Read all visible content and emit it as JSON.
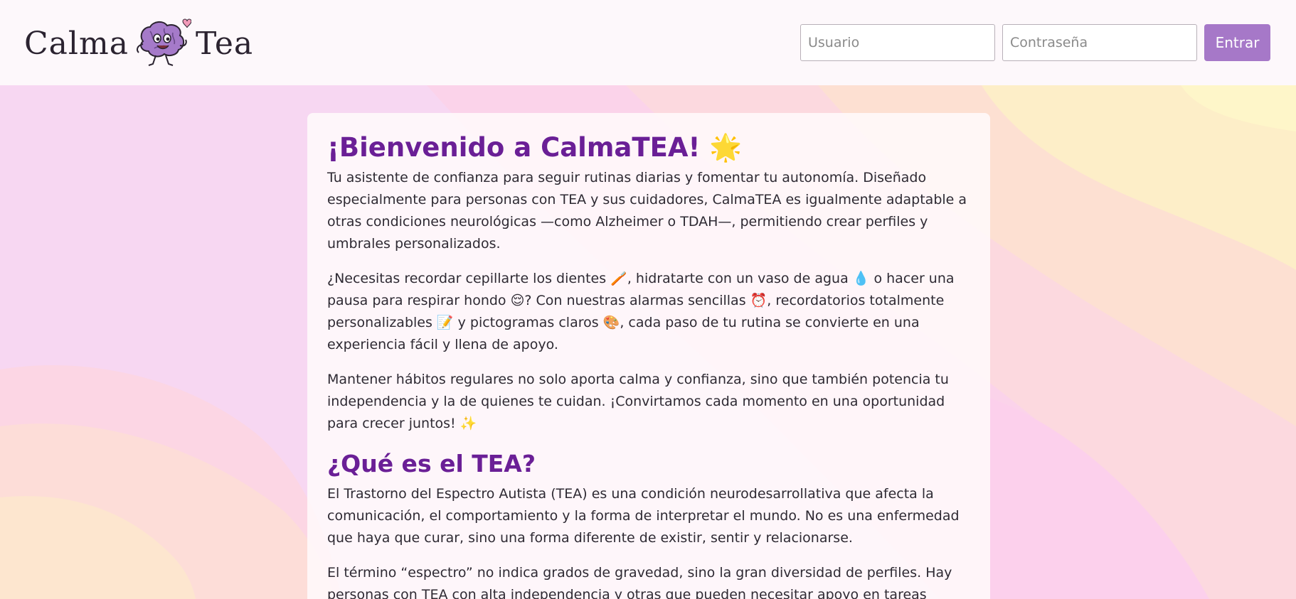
{
  "header": {
    "logo": {
      "word_left": "Calma",
      "word_right": "Tea"
    },
    "login": {
      "username_placeholder": "Usuario",
      "password_placeholder": "Contraseña",
      "submit_label": "Entrar"
    }
  },
  "main": {
    "welcome_title": "¡Bienvenido a CalmaTEA! 🌟",
    "welcome_paragraphs": [
      "Tu asistente de confianza para seguir rutinas diarias y fomentar tu autonomía. Diseñado especialmente para personas con TEA y sus cuidadores, CalmaTEA es igualmente adaptable a otras condiciones neurológicas —como Alzheimer o TDAH—, permitiendo crear perfiles y umbrales personalizados.",
      "¿Necesitas recordar cepillarte los dientes 🪥, hidratarte con un vaso de agua 💧 o hacer una pausa para respirar hondo 😌? Con nuestras alarmas sencillas ⏰, recordatorios totalmente personalizables 📝 y pictogramas claros 🎨, cada paso de tu rutina se convierte en una experiencia fácil y llena de apoyo.",
      "Mantener hábitos regulares no solo aporta calma y confianza, sino que también potencia tu independencia y la de quienes te cuidan. ¡Convirtamos cada momento en una oportunidad para crecer juntos! ✨"
    ],
    "tea_title": "¿Qué es el TEA?",
    "tea_paragraphs": [
      "El Trastorno del Espectro Autista (TEA) es una condición neurodesarrollativa que afecta la comunicación, el comportamiento y la forma de interpretar el mundo. No es una enfermedad que haya que curar, sino una forma diferente de existir, sentir y relacionarse.",
      "El término “espectro” no indica grados de gravedad, sino la gran diversidad de perfiles. Hay personas con TEA con alta independencia y otras que pueden necesitar apoyo en tareas"
    ]
  },
  "colors": {
    "header_bg": "#fdf8fb",
    "title_purple": "#6a1f96",
    "button_purple": "#a678c8",
    "text": "#2e2a33"
  }
}
